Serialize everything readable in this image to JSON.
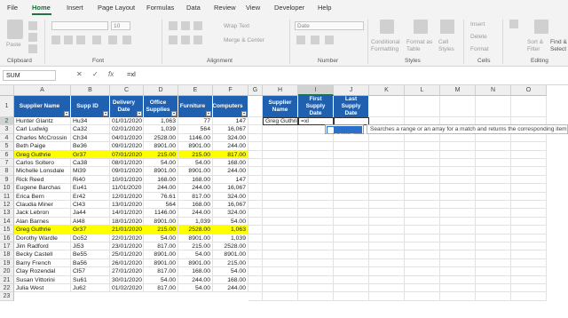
{
  "ribbon_tabs": [
    "File",
    "Home",
    "Insert",
    "Page Layout",
    "Formulas",
    "Data",
    "Review",
    "View",
    "Developer",
    "Help"
  ],
  "active_tab": "Home",
  "ribbon": {
    "paste": "Paste",
    "clipboard": "Clipboard",
    "font": "Font",
    "font_size": "10",
    "alignment": "Alignment",
    "wrap_text": "Wrap Text",
    "merge_center": "Merge & Center",
    "number_format": "Date",
    "number": "Number",
    "conditional_formatting": "Conditional Formatting",
    "format_as_table": "Format as Table",
    "cell_styles": "Cell Styles",
    "styles": "Styles",
    "insert": "Insert",
    "delete": "Delete",
    "format": "Format",
    "cells": "Cells",
    "sort_filter": "Sort & Filter",
    "find_select": "Find & Select",
    "editing": "Editing"
  },
  "formula_bar": {
    "name_box": "SUM",
    "cancel": "✕",
    "enter": "✓",
    "fx": "fx",
    "formula": "=xl"
  },
  "columns": [
    "A",
    "B",
    "C",
    "D",
    "E",
    "F",
    "G",
    "H",
    "I",
    "J",
    "K",
    "L",
    "M",
    "N",
    "O"
  ],
  "table_headers": [
    "Supplier Name",
    "Supp ID",
    "Delivery Date",
    "Office Supplies",
    "Furniture",
    "Computers"
  ],
  "rows": [
    [
      "Hunter Glantz",
      "Hu34",
      "01/01/2020",
      "1,063",
      "77",
      "147"
    ],
    [
      "Carl Ludwig",
      "Ca32",
      "02/01/2020",
      "1,039",
      "564",
      "16,067"
    ],
    [
      "Charles McCrossin",
      "Ch34",
      "04/01/2020",
      "2528.00",
      "1146.00",
      "324.00"
    ],
    [
      "Beth Paige",
      "Be36",
      "09/01/2020",
      "8901.00",
      "8901.00",
      "244.00"
    ],
    [
      "Greg Guthrie",
      "Gr37",
      "07/01/2020",
      "215.00",
      "215.00",
      "817.00"
    ],
    [
      "Carlos Soltero",
      "Ca38",
      "08/01/2020",
      "54.00",
      "54.00",
      "168.00"
    ],
    [
      "Michelle Lonsdale",
      "Mi39",
      "09/01/2020",
      "8901.00",
      "8901.00",
      "244.00"
    ],
    [
      "Rick Reed",
      "Ri40",
      "10/01/2020",
      "168.00",
      "168.00",
      "147"
    ],
    [
      "Eugene Barchas",
      "Eu41",
      "11/01/2020",
      "244.00",
      "244.00",
      "16,067"
    ],
    [
      "Erica Bern",
      "Er42",
      "12/01/2020",
      "76.61",
      "817.00",
      "324.00"
    ],
    [
      "Claudia Miner",
      "Cl43",
      "13/01/2020",
      "564",
      "168.00",
      "16,067"
    ],
    [
      "Jack Lebron",
      "Ja44",
      "14/01/2020",
      "1146.00",
      "244.00",
      "324.00"
    ],
    [
      "Alan Barnes",
      "Al48",
      "18/01/2020",
      "8901.00",
      "1,039",
      "54.00"
    ],
    [
      "Greg Guthrie",
      "Gr37",
      "21/01/2020",
      "215.00",
      "2528.00",
      "1,063"
    ],
    [
      "Dorothy Wardle",
      "Do52",
      "22/01/2020",
      "54.00",
      "8901.00",
      "1,039"
    ],
    [
      "Jim Radford",
      "Ji53",
      "23/01/2020",
      "817.00",
      "215.00",
      "2528.00"
    ],
    [
      "Becky Castell",
      "Be55",
      "25/01/2020",
      "8901.00",
      "54.00",
      "8901.00"
    ],
    [
      "Barry French",
      "Ba56",
      "26/01/2020",
      "8901.00",
      "8901.00",
      "215.00"
    ],
    [
      "Clay Rozendal",
      "Cl57",
      "27/01/2020",
      "817.00",
      "168.00",
      "54.00"
    ],
    [
      "Susan Vittorini",
      "Su61",
      "30/01/2020",
      "54.00",
      "244.00",
      "168.00"
    ],
    [
      "Julia West",
      "Ju62",
      "01/02/2020",
      "817.00",
      "54.00",
      "244.00"
    ]
  ],
  "highlight_rows": [
    6,
    15
  ],
  "lookup_headers": [
    "Supplier Name",
    "First Supply Date",
    "Last Supply Date"
  ],
  "lookup_name": "Greg Guthrie",
  "lookup_formula": "=xl",
  "autocomplete": {
    "item": "XLOOKUP",
    "tooltip": "Searches a range or an array for a match and returns the corresponding item"
  }
}
